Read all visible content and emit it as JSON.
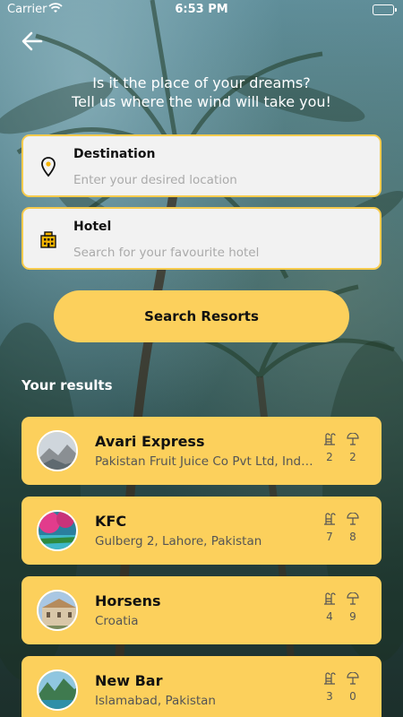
{
  "status_bar": {
    "carrier": "Carrier",
    "time": "6:53 PM"
  },
  "heading": {
    "line1": "Is it the place of your dreams?",
    "line2": "Tell us where the wind will take you!"
  },
  "destination": {
    "label": "Destination",
    "placeholder": "Enter your desired location",
    "value": "",
    "icon": "location-pin-icon"
  },
  "hotel": {
    "label": "Hotel",
    "placeholder": "Search for your favourite hotel",
    "value": "",
    "icon": "building-icon"
  },
  "search_button": {
    "label": "Search Resorts"
  },
  "results": {
    "title": "Your results",
    "items": [
      {
        "name": "Avari Express",
        "address": "Pakistan Fruit Juice Co Pvt Ltd, Industrial Area",
        "pools": "2",
        "beaches": "2"
      },
      {
        "name": "KFC",
        "address": "Gulberg 2, Lahore, Pakistan",
        "pools": "7",
        "beaches": "8"
      },
      {
        "name": "Horsens",
        "address": "Croatia",
        "pools": "4",
        "beaches": "9"
      },
      {
        "name": "New Bar",
        "address": "Islamabad, Pakistan",
        "pools": "3",
        "beaches": "0"
      }
    ]
  },
  "colors": {
    "accent": "#fcd05c",
    "field_border": "#f7cb4d",
    "field_bg": "#f2f2f2"
  }
}
